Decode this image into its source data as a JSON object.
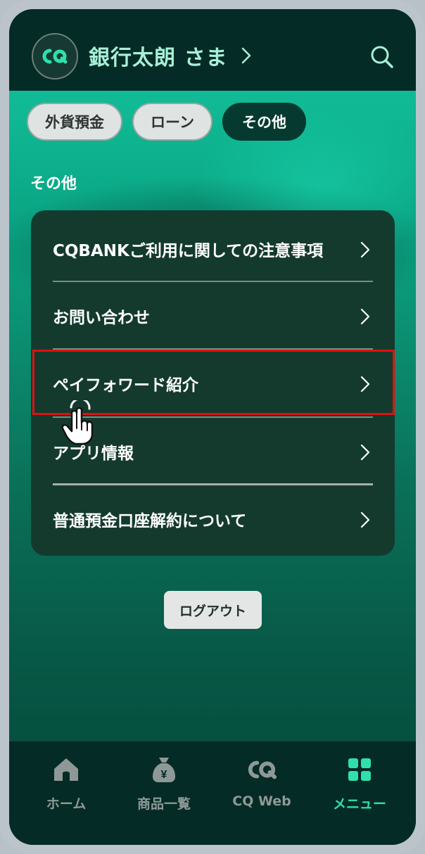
{
  "header": {
    "logo_text": "CQ",
    "user_name": "銀行太朗 さま"
  },
  "tabs": [
    {
      "label": "外貨預金",
      "active": false
    },
    {
      "label": "ローン",
      "active": false
    },
    {
      "label": "その他",
      "active": true
    }
  ],
  "section_title": "その他",
  "menu_items": [
    {
      "label": "CQBANKご利用に関しての注意事項"
    },
    {
      "label": "お問い合わせ"
    },
    {
      "label": "ペイフォワード紹介",
      "highlighted": true
    },
    {
      "label": "アプリ情報"
    },
    {
      "label": "普通預金口座解約について"
    }
  ],
  "logout_label": "ログアウト",
  "bottom_nav": [
    {
      "label": "ホーム",
      "icon": "home-icon",
      "active": false
    },
    {
      "label": "商品一覧",
      "icon": "money-bag-icon",
      "active": false
    },
    {
      "label": "CQ Web",
      "icon": "cq-web-icon",
      "active": false
    },
    {
      "label": "メニュー",
      "icon": "grid-menu-icon",
      "active": true
    }
  ],
  "colors": {
    "header_bg": "#042b25",
    "card_bg": "#143a2e",
    "accent": "#2fe0ad",
    "highlight": "#e01010"
  }
}
